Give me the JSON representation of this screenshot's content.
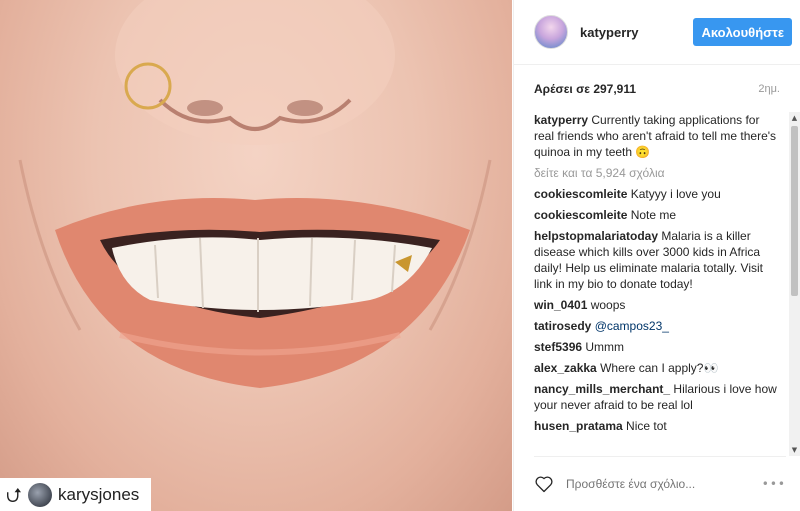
{
  "post": {
    "photo_alt": "",
    "repost": {
      "icon": "repost-icon",
      "username": "karysjones"
    }
  },
  "header": {
    "username": "katyperry",
    "follow_label": "Ακολουθήστε"
  },
  "stats": {
    "likes": "Αρέσει σε 297,911",
    "time": "2ημ."
  },
  "caption": {
    "username": "katyperry",
    "text": "Currently taking applications for real friends who aren't afraid to tell me there's quinoa in my teeth 🙃"
  },
  "view_all": "δείτε και τα 5,924 σχόλια",
  "comments": [
    {
      "user": "cookiescomleite",
      "text": "Katyyy i love you"
    },
    {
      "user": "cookiescomleite",
      "text": "Note me"
    },
    {
      "user": "helpstopmalariatoday",
      "text": "Malaria is a killer disease which kills over 3000 kids in Africa daily! Help us eliminate malaria totally. Visit link in my bio to donate today!"
    },
    {
      "user": "win_0401",
      "text": "woops"
    },
    {
      "user": "tatirosedy",
      "text": "@campos23_"
    },
    {
      "user": "stef5396",
      "text": "Ummm"
    },
    {
      "user": "alex_zakka",
      "text": "Where can I apply?👀"
    },
    {
      "user": "nancy_mills_merchant_",
      "text": "Hilarious i love how your never afraid to be real lol"
    },
    {
      "user": "husen_pratama",
      "text": "Nice tot"
    }
  ],
  "footer": {
    "like_icon": "heart-icon",
    "comment_placeholder": "Προσθέστε ένα σχόλιο...",
    "more_icon": "more-options-icon"
  },
  "colors": {
    "follow_button": "#3897f0",
    "mention": "#003569",
    "muted_text": "#999999"
  }
}
